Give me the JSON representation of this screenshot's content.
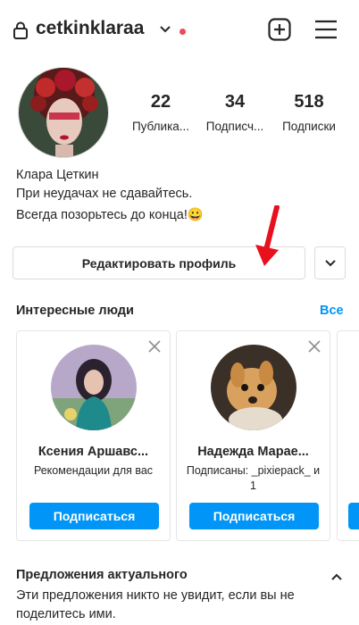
{
  "header": {
    "username": "cetkinklaraa"
  },
  "profile": {
    "stats": [
      {
        "value": "22",
        "label": "Публика..."
      },
      {
        "value": "34",
        "label": "Подписч..."
      },
      {
        "value": "518",
        "label": "Подписки"
      }
    ],
    "full_name": "Клара Цеткин",
    "bio_line1": "При неудачах не сдавайтесь.",
    "bio_line2": "Всегда позорьтесь до конца!😀",
    "edit_button": "Редактировать профиль"
  },
  "suggestions": {
    "title": "Интересные люди",
    "see_all": "Все",
    "cards": [
      {
        "name": "Ксения Аршавс...",
        "subtitle": "Рекомендации для вас",
        "follow": "Подписаться"
      },
      {
        "name": "Надежда Марае...",
        "subtitle": "Подписаны: _pixiepack_ и 1",
        "follow": "Подписаться"
      }
    ]
  },
  "highlights": {
    "title": "Предложения актуального",
    "text": "Эти предложения никто не увидит, если вы не поделитесь ими."
  },
  "colors": {
    "accent": "#0095f6",
    "notification_dot": "#ed4956",
    "annotation_arrow": "#e8101c"
  }
}
